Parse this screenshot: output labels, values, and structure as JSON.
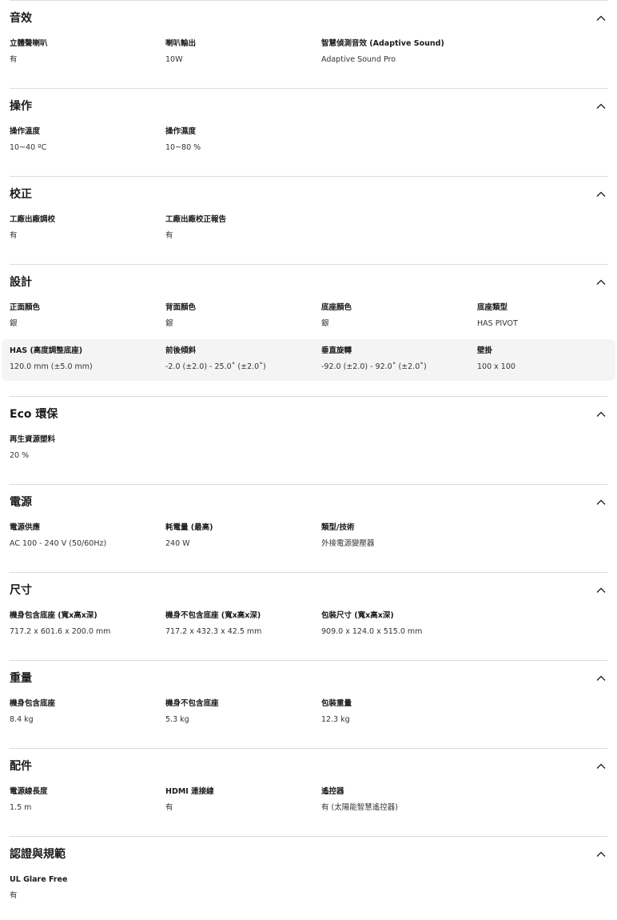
{
  "sections": {
    "audio": {
      "title": "音效",
      "items": [
        {
          "label": "立體聲喇叭",
          "value": "有"
        },
        {
          "label": "喇叭輸出",
          "value": "10W"
        },
        {
          "label": "智慧偵測音效 (Adaptive Sound)",
          "value": "Adaptive Sound Pro"
        }
      ]
    },
    "operation": {
      "title": "操作",
      "items": [
        {
          "label": "操作溫度",
          "value": "10~40 ºC"
        },
        {
          "label": "操作濕度",
          "value": "10~80 %"
        }
      ]
    },
    "calibration": {
      "title": "校正",
      "items": [
        {
          "label": "工廠出廠調校",
          "value": "有"
        },
        {
          "label": "工廠出廠校正報告",
          "value": "有"
        }
      ]
    },
    "design": {
      "title": "設計",
      "items": [
        {
          "label": "正面顏色",
          "value": "銀"
        },
        {
          "label": "背面顏色",
          "value": "銀"
        },
        {
          "label": "底座顏色",
          "value": "銀"
        },
        {
          "label": "底座類型",
          "value": "HAS PIVOT"
        },
        {
          "label": "HAS (高度調整底座)",
          "value": "120.0 mm (±5.0 mm)"
        },
        {
          "label": "前後傾斜",
          "value": "-2.0 (±2.0) - 25.0˚ (±2.0˚)"
        },
        {
          "label": "垂直旋轉",
          "value": "-92.0 (±2.0) - 92.0˚ (±2.0˚)"
        },
        {
          "label": "壁掛",
          "value": "100 x 100"
        }
      ]
    },
    "eco": {
      "title": "Eco 環保",
      "items": [
        {
          "label": "再生資源塑料",
          "value": "20 %"
        }
      ]
    },
    "power": {
      "title": "電源",
      "items": [
        {
          "label": "電源供應",
          "value": "AC 100 - 240 V (50/60Hz)"
        },
        {
          "label": "耗電量 (最高)",
          "value": "240 W"
        },
        {
          "label": "類型/技術",
          "value": "外接電源變壓器"
        }
      ]
    },
    "dimension": {
      "title": "尺寸",
      "items": [
        {
          "label": "機身包含底座 (寬x高x深)",
          "value": "717.2 x 601.6 x 200.0 mm"
        },
        {
          "label": "機身不包含底座 (寬x高x深)",
          "value": "717.2 x 432.3 x 42.5 mm"
        },
        {
          "label": "包裝尺寸 (寬x高x深)",
          "value": "909.0 x 124.0 x 515.0 mm"
        }
      ]
    },
    "weight": {
      "title": "重量",
      "items": [
        {
          "label": "機身包含底座",
          "value": "8.4 kg"
        },
        {
          "label": "機身不包含底座",
          "value": "5.3 kg"
        },
        {
          "label": "包裝重量",
          "value": "12.3 kg"
        }
      ]
    },
    "accessory": {
      "title": "配件",
      "items": [
        {
          "label": "電源線長度",
          "value": "1.5 m"
        },
        {
          "label": "HDMI 連接線",
          "value": "有"
        },
        {
          "label": "遙控器",
          "value": "有 (太陽能智慧遙控器)"
        }
      ]
    },
    "certification": {
      "title": "認證與規範",
      "items": [
        {
          "label": "UL Glare Free",
          "value": "有"
        }
      ]
    }
  }
}
